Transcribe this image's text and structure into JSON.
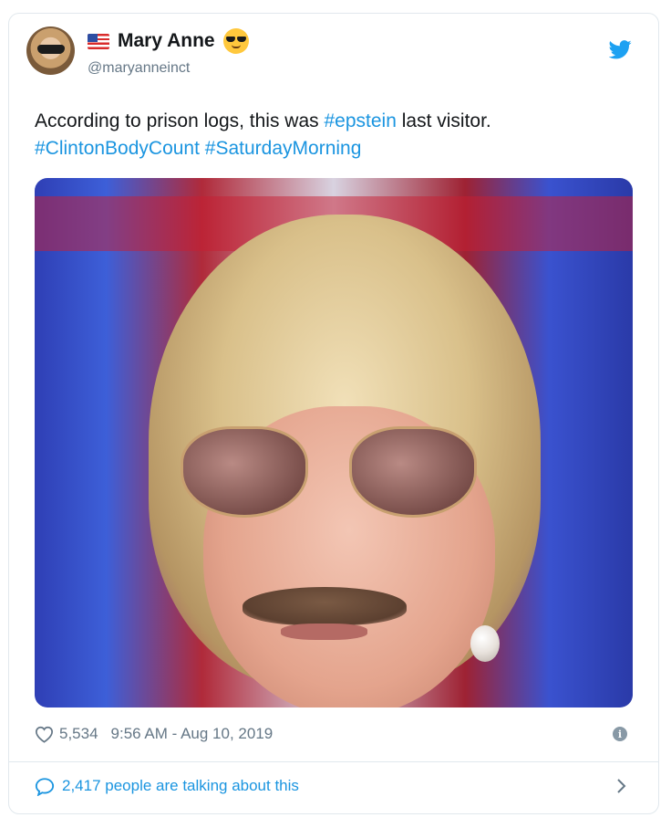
{
  "author": {
    "display_name": "Mary Anne",
    "handle": "@maryanneinct",
    "flag_icon": "us-flag-icon",
    "emoji_icon": "sunglasses-emoji-icon"
  },
  "tweet": {
    "text_before": "According to prison logs, this was ",
    "hashtag_1": "#epstein",
    "text_after": " last visitor.",
    "hashtag_2": "#ClintonBodyCount",
    "hashtag_3": "#SaturdayMorning"
  },
  "meta": {
    "like_count": "5,534",
    "timestamp": "9:56 AM - Aug 10, 2019"
  },
  "talking": {
    "label": "2,417 people are talking about this"
  },
  "colors": {
    "link": "#1b95e0",
    "secondary_text": "#657786",
    "border": "#e1e8ed"
  }
}
